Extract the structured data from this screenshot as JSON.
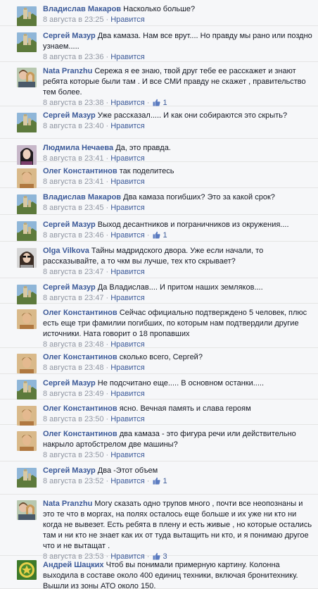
{
  "like_label": "Нравится",
  "comments": [
    {
      "author": "Владислав Макаров",
      "text": "Насколько больше?",
      "time": "8 августа в 23:25",
      "likes": "",
      "avatar": "landscape-castle"
    },
    {
      "author": "Сергей Мазур",
      "text": "Два камаза. Нам все врут.... Но правду мы рано или поздно узнаем.....",
      "time": "8 августа в 23:36",
      "likes": "",
      "avatar": "landscape-castle"
    },
    {
      "author": "Nata Pranzhu",
      "text": "Сережа я ее знаю, твой друг тебе ее расскажет и знают ребята которые были там . И все СМИ правду не скажет , правительство тем более.",
      "time": "8 августа в 23:38",
      "likes": "1",
      "avatar": "couple"
    },
    {
      "author": "Сергей Мазур",
      "text": "Уже рассказал..... И как они собираются это скрыть?",
      "time": "8 августа в 23:40",
      "likes": "",
      "avatar": "landscape-castle"
    },
    {
      "author": "Людмила Нечаева",
      "text": "Да, это правда.",
      "time": "8 августа в 23:41",
      "likes": "",
      "avatar": "woman-dark-hair"
    },
    {
      "author": "Олег Константинов",
      "text": "так поделитесь",
      "time": "8 августа в 23:41",
      "likes": "",
      "avatar": "man-portrait"
    },
    {
      "author": "Владислав Макаров",
      "text": "Два камаза погибших? Это за какой срок?",
      "time": "8 августа в 23:45",
      "likes": "",
      "avatar": "landscape-castle"
    },
    {
      "author": "Сергей Мазур",
      "text": "Выход десантников и пограничников из окружения....",
      "time": "8 августа в 23:46",
      "likes": "1",
      "avatar": "landscape-castle"
    },
    {
      "author": "Olga Vilkova",
      "text": "Тайны мадридского двора. Уже если начали, то рассказывайте, а то чкм вы лучше, тех кто скрывает?",
      "time": "8 августа в 23:47",
      "likes": "",
      "avatar": "woman-sunglasses"
    },
    {
      "author": "Сергей Мазур",
      "text": "Да Владислав.... И притом наших земляков....",
      "time": "8 августа в 23:47",
      "likes": "",
      "avatar": "landscape-castle"
    },
    {
      "author": "Олег Константинов",
      "text": "Сейчас официально подтверждено 5 человек, плюс есть еще три фамилии погибших, по которым нам подтвердили другие источники. Ната говорит о 18 пропавших",
      "time": "8 августа в 23:48",
      "likes": "",
      "avatar": "man-portrait"
    },
    {
      "author": "Олег Константинов",
      "text": "сколько всего, Сергей?",
      "time": "8 августа в 23:48",
      "likes": "",
      "avatar": "man-portrait"
    },
    {
      "author": "Сергей Мазур",
      "text": "Не подсчитано еще..... В основном останки.....",
      "time": "8 августа в 23:49",
      "likes": "",
      "avatar": "landscape-castle"
    },
    {
      "author": "Олег Константинов",
      "text": "ясно. Вечная память и слава героям",
      "time": "8 августа в 23:50",
      "likes": "",
      "avatar": "man-portrait"
    },
    {
      "author": "Олег Константинов",
      "text": "два камаза - это фигура речи или действительно накрыло артобстрелом две машины?",
      "time": "8 августа в 23:50",
      "likes": "",
      "avatar": "man-portrait"
    },
    {
      "author": "Сергей Мазур",
      "text": "Два -Этот объем",
      "time": "8 августа в 23:52",
      "likes": "1",
      "avatar": "landscape-castle"
    },
    {
      "author": "Nata Pranzhu",
      "text": "Могу сказать одно трупов много , почти все неопознаны и это те что в моргах, на полях осталось еще больше и их уже ни кто ни когда не вывезет. Есть ребята в плену и есть живые , но которые остались там и ни кто не знает как их от туда вытащить ни кто, и я понимаю другое что и не вытащат .",
      "time": "8 августа в 23:53",
      "likes": "3",
      "avatar": "couple"
    },
    {
      "author": "Андрей Шацких",
      "text": "Чтоб вы понимали примерную картину. Колонна выходила в составе около 400 единиц техники, включая бронитехнику. Вышли из зоны АТО около 150.",
      "time": "",
      "likes": "",
      "avatar": "green-emblem"
    }
  ]
}
